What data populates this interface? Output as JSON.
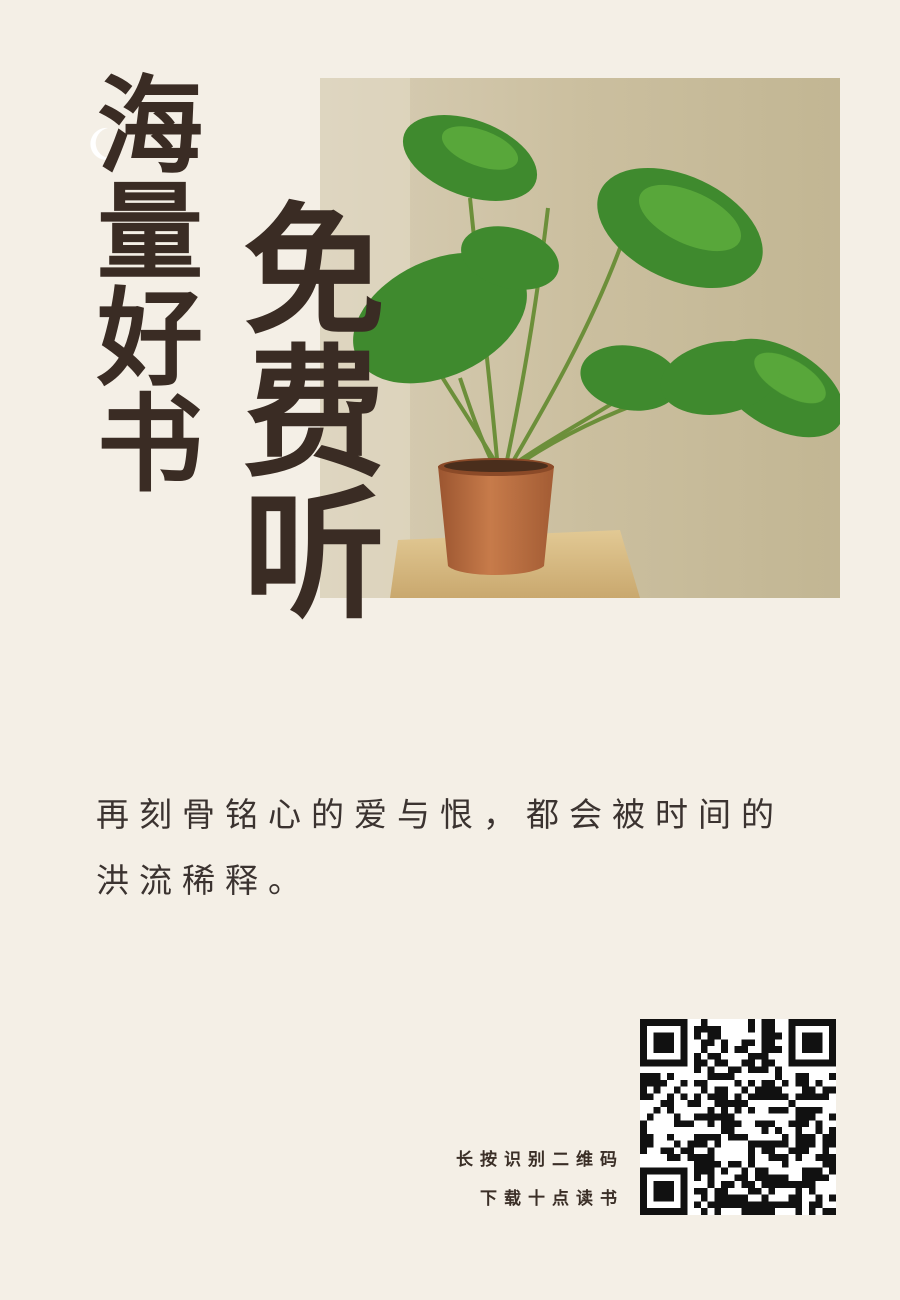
{
  "title_left": "海量好书",
  "title_right": "免费听",
  "quote": "再刻骨铭心的爱与恨，都会被时间的洪流稀释。",
  "qr_caption_line1": "长按识别二维码",
  "qr_caption_line2": "下载十点读书",
  "icons": {
    "decoration": "crescent-moon-icon",
    "photo": "potted-monstera-plant",
    "code": "qr-code"
  },
  "colors": {
    "background": "#f4efe6",
    "title": "#3a2c24",
    "leaf": "#3f8a2e",
    "pot": "#b86a3e"
  }
}
